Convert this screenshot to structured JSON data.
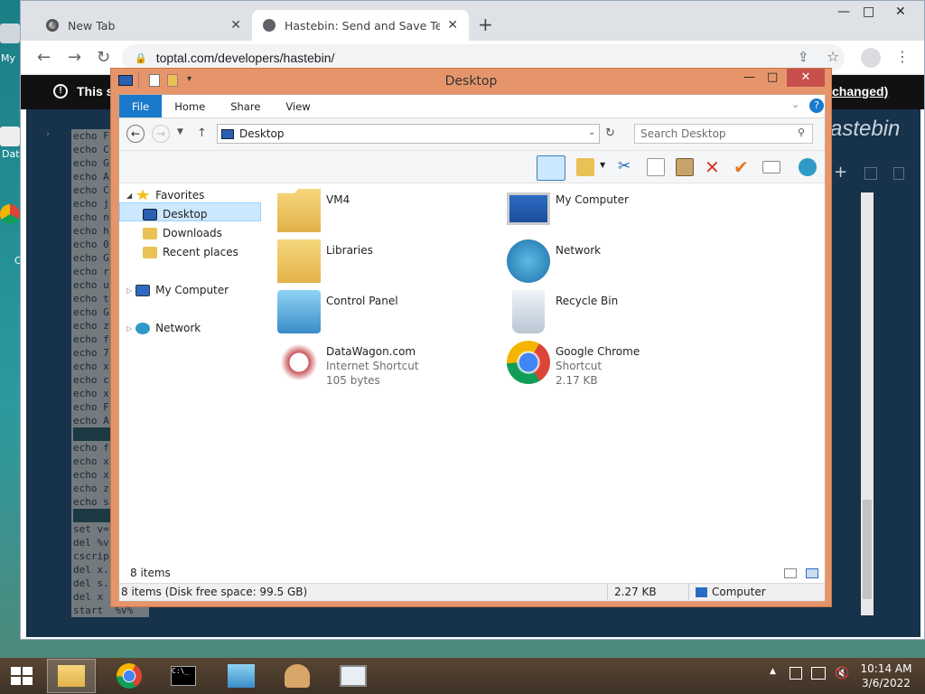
{
  "desktop": {
    "left_icons": [
      {
        "label": "My",
        "icon": "computer-icon"
      },
      {
        "label": "Dat",
        "icon": "app-icon"
      },
      {
        "label": "C",
        "icon": "chrome-icon"
      }
    ]
  },
  "browser": {
    "tabs": [
      {
        "title": "New Tab",
        "icon": "chrome-icon",
        "active": false
      },
      {
        "title": "Hastebin: Send and Save Text or",
        "icon": "globe-icon",
        "active": true
      }
    ],
    "new_tab": "+",
    "window_controls": {
      "minimize": "—",
      "maximize": "□",
      "close": "✕"
    },
    "nav": {
      "back": "←",
      "forward": "→",
      "reload": "↻"
    },
    "url": "toptal.com/developers/hastebin/",
    "banner": {
      "prefix": "This s",
      "suffix": "changed)"
    },
    "hastebin_logo": "astebin",
    "code_lines": [
      "echo F",
      "echo C",
      "echo G",
      "echo A",
      "echo C",
      "echo j",
      "echo n",
      "echo h",
      "echo 0",
      "echo G",
      "echo r",
      "echo u",
      "echo t",
      "echo G",
      "echo z",
      "echo f",
      "echo 7",
      "echo x",
      "echo c",
      "echo x",
      "echo F",
      "echo A",
      "",
      "echo f",
      "echo x",
      "echo x",
      "echo z",
      "echo s",
      "",
      "set v=",
      "del %v",
      "cscrip",
      "del x.",
      "del s.",
      "del x",
      "start  %v%"
    ]
  },
  "explorer": {
    "title": "Desktop",
    "window_controls": {
      "minimize": "—",
      "maximize": "□",
      "close": "✕"
    },
    "ribbon_tabs": [
      "File",
      "Home",
      "Share",
      "View"
    ],
    "address": "Desktop",
    "search_placeholder": "Search Desktop",
    "nav_tree": [
      {
        "label": "Favorites",
        "level": 0,
        "icon": "star-icon"
      },
      {
        "label": "Desktop",
        "level": 1,
        "icon": "desktop-icon",
        "selected": true
      },
      {
        "label": "Downloads",
        "level": 1,
        "icon": "downloads-icon"
      },
      {
        "label": "Recent places",
        "level": 1,
        "icon": "recent-places-icon"
      },
      {
        "label": "My Computer",
        "level": 0,
        "icon": "computer-icon"
      },
      {
        "label": "Network",
        "level": 0,
        "icon": "network-icon"
      }
    ],
    "items": [
      {
        "name": "VM4",
        "line2": "",
        "line3": "",
        "icon": "user-folder-icon"
      },
      {
        "name": "My Computer",
        "line2": "",
        "line3": "",
        "icon": "computer-icon"
      },
      {
        "name": "Libraries",
        "line2": "",
        "line3": "",
        "icon": "libraries-icon"
      },
      {
        "name": "Network",
        "line2": "",
        "line3": "",
        "icon": "network-icon"
      },
      {
        "name": "Control Panel",
        "line2": "",
        "line3": "",
        "icon": "control-panel-icon"
      },
      {
        "name": "Recycle Bin",
        "line2": "",
        "line3": "",
        "icon": "recycle-bin-icon"
      },
      {
        "name": "DataWagon.com",
        "line2": "Internet Shortcut",
        "line3": "105 bytes",
        "icon": "internet-shortcut-icon"
      },
      {
        "name": "Google Chrome",
        "line2": "Shortcut",
        "line3": "2.17 KB",
        "icon": "chrome-icon"
      }
    ],
    "item_count": "8 items",
    "status": {
      "summary": "8 items (Disk free space: 99.5 GB)",
      "size": "2.27 KB",
      "location": "Computer"
    }
  },
  "taskbar": {
    "apps": [
      {
        "name": "file-explorer",
        "icon": "folder-icon",
        "active": true
      },
      {
        "name": "google-chrome",
        "icon": "chrome-icon",
        "active": false
      },
      {
        "name": "command-prompt",
        "icon": "cmd-icon",
        "active": false
      },
      {
        "name": "control-panel",
        "icon": "control-panel-icon",
        "active": false
      },
      {
        "name": "users",
        "icon": "users-icon",
        "active": false
      },
      {
        "name": "performance-monitor",
        "icon": "monitor-icon",
        "active": false
      }
    ],
    "clock": {
      "time": "10:14 AM",
      "date": "3/6/2022"
    }
  },
  "colors": {
    "explorer_frame": "#e6956b",
    "ribbon_file": "#1979ca",
    "selection": "#cce8ff",
    "hastebin_bg": "#17324b",
    "banner_bg": "#111111"
  }
}
